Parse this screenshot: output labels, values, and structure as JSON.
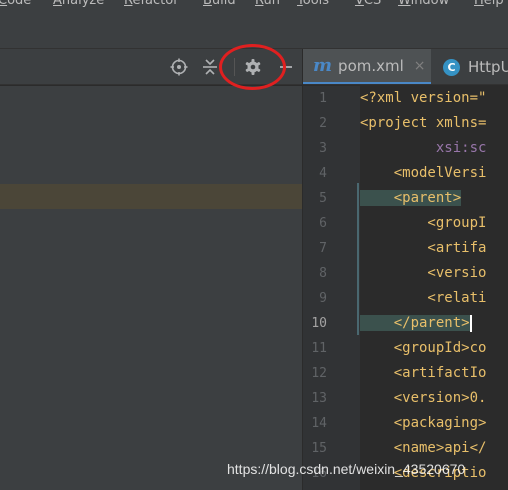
{
  "menu": [
    "Code",
    "Analyze",
    "Refactor",
    "Build",
    "Run",
    "Tools",
    "VCS",
    "Window",
    "Help"
  ],
  "tool_header": {
    "icons": [
      "locate-icon",
      "collapse-all-icon",
      "gear-icon",
      "hide-icon"
    ]
  },
  "editor": {
    "tabs": [
      {
        "icon": "m",
        "label": "pom.xml",
        "close": "×",
        "active": true
      },
      {
        "icon": "C",
        "label": "HttpU",
        "active": false
      }
    ],
    "current_line": 10,
    "lines": [
      {
        "n": "1",
        "text": "<?xml version=\""
      },
      {
        "n": "2",
        "text": "<project xmlns="
      },
      {
        "n": "3",
        "text": "         xsi:sc"
      },
      {
        "n": "4",
        "text": "    <modelVersi"
      },
      {
        "n": "5",
        "text": "    <parent>"
      },
      {
        "n": "6",
        "text": "        <groupI"
      },
      {
        "n": "7",
        "text": "        <artifa"
      },
      {
        "n": "8",
        "text": "        <versio"
      },
      {
        "n": "9",
        "text": "        <relati"
      },
      {
        "n": "10",
        "text": "    </parent>"
      },
      {
        "n": "11",
        "text": "    <groupId>co"
      },
      {
        "n": "12",
        "text": "    <artifactIo"
      },
      {
        "n": "13",
        "text": "    <version>0."
      },
      {
        "n": "14",
        "text": "    <packaging>"
      },
      {
        "n": "15",
        "text": "    <name>api</"
      },
      {
        "n": "16",
        "text": "    <descriptio"
      }
    ]
  },
  "watermark": "https://blog.csdn.net/weixin_43520670",
  "colors": {
    "accent": "#4a88c7",
    "annotation": "#e02020",
    "xml_tag": "#e8bf6a"
  }
}
